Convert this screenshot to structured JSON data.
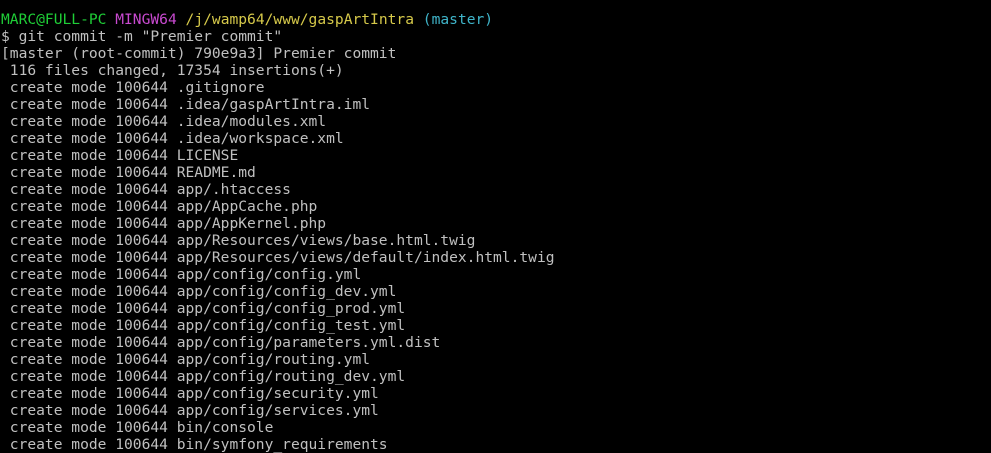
{
  "prompt": {
    "user_host": "MARC@FULL-PC",
    "env": "MINGW64",
    "path": "/j/wamp64/www/gaspArtIntra",
    "branch": "(master)"
  },
  "command_line": "$ git commit -m \"Premier commit\"",
  "summary_line": "[master (root-commit) 790e9a3] Premier commit",
  "stats_line": " 116 files changed, 17354 insertions(+)",
  "created_files": [
    " create mode 100644 .gitignore",
    " create mode 100644 .idea/gaspArtIntra.iml",
    " create mode 100644 .idea/modules.xml",
    " create mode 100644 .idea/workspace.xml",
    " create mode 100644 LICENSE",
    " create mode 100644 README.md",
    " create mode 100644 app/.htaccess",
    " create mode 100644 app/AppCache.php",
    " create mode 100644 app/AppKernel.php",
    " create mode 100644 app/Resources/views/base.html.twig",
    " create mode 100644 app/Resources/views/default/index.html.twig",
    " create mode 100644 app/config/config.yml",
    " create mode 100644 app/config/config_dev.yml",
    " create mode 100644 app/config/config_prod.yml",
    " create mode 100644 app/config/config_test.yml",
    " create mode 100644 app/config/parameters.yml.dist",
    " create mode 100644 app/config/routing.yml",
    " create mode 100644 app/config/routing_dev.yml",
    " create mode 100644 app/config/security.yml",
    " create mode 100644 app/config/services.yml",
    " create mode 100644 bin/console",
    " create mode 100644 bin/symfony_requirements"
  ],
  "colors": {
    "background": "#000000",
    "text": "#c0c0c0",
    "user_host": "#1fcf37",
    "env": "#c94ad1",
    "path": "#d6c94a",
    "branch": "#3fb4c9"
  }
}
